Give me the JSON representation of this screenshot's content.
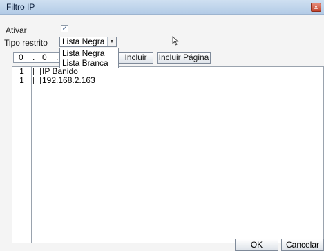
{
  "window": {
    "title": "Filtro IP",
    "close_label": "x"
  },
  "form": {
    "enable_label": "Ativar",
    "enable_checked": true,
    "enable_check_mark": "✓",
    "restrict_label": "Tipo restrito",
    "restrict_value": "Lista Negra",
    "dropdown_arrow": "▼",
    "dropdown_options": [
      "Lista Negra",
      "Lista Branca"
    ]
  },
  "ip_input": {
    "oct1": "0",
    "dot1": ".",
    "oct2": "0",
    "dot2": "."
  },
  "buttons": {
    "include": "Incluir",
    "include_page": "Incluir Página"
  },
  "list": {
    "rows": [
      {
        "num": "1",
        "text": "IP Banido"
      },
      {
        "num": "1",
        "text": "192.168.2.163"
      }
    ]
  },
  "footer": {
    "ok": "OK",
    "cancel": "Cancelar"
  }
}
